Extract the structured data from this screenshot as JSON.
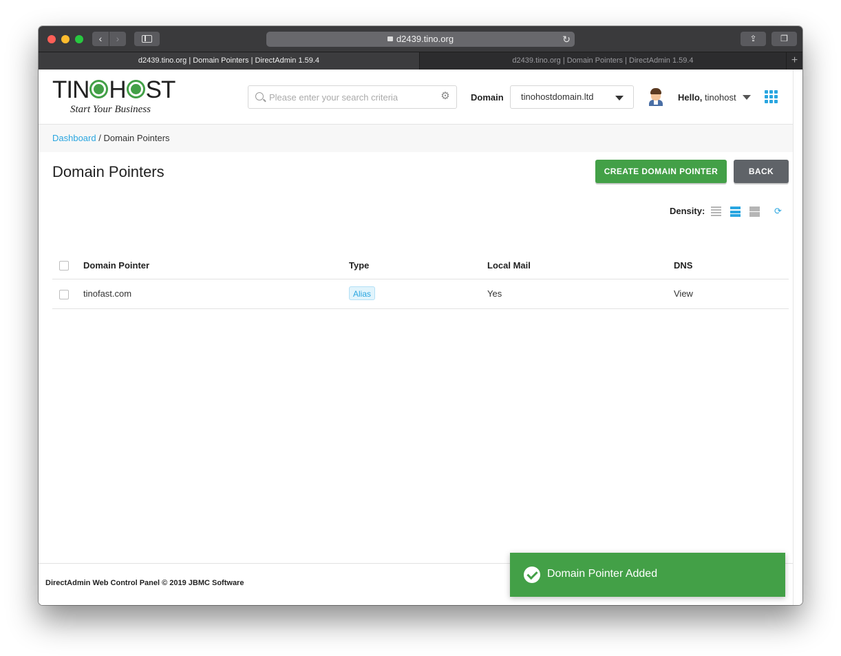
{
  "browser": {
    "url": "d2439.tino.org",
    "tabs": [
      {
        "label": "d2439.tino.org | Domain Pointers | DirectAdmin 1.59.4",
        "active": true
      },
      {
        "label": "d2439.tino.org | Domain Pointers | DirectAdmin 1.59.4",
        "active": false
      }
    ]
  },
  "header": {
    "logo_text_left": "TIN",
    "logo_text_right": "ST",
    "logo_text_mid": "H",
    "logo_tagline": "Start Your Business",
    "search_placeholder": "Please enter your search criteria",
    "domain_label": "Domain",
    "domain_value": "tinohostdomain.ltd",
    "hello_prefix": "Hello,",
    "username": "tinohost"
  },
  "breadcrumb": {
    "home": "Dashboard",
    "separator": " / ",
    "current": "Domain Pointers"
  },
  "page": {
    "title": "Domain Pointers",
    "create_button": "CREATE DOMAIN POINTER",
    "back_button": "BACK",
    "density_label": "Density:"
  },
  "table": {
    "columns": [
      "Domain Pointer",
      "Type",
      "Local Mail",
      "DNS"
    ],
    "rows": [
      {
        "domain": "tinofast.com",
        "type": "Alias",
        "local_mail": "Yes",
        "dns": "View"
      }
    ]
  },
  "footer": {
    "text": "DirectAdmin Web Control Panel © 2019 JBMC Software"
  },
  "toast": {
    "message": "Domain Pointer Added"
  },
  "colors": {
    "accent": "#2aa6e0",
    "primary_green": "#43a047",
    "back_gray": "#5f6368"
  }
}
